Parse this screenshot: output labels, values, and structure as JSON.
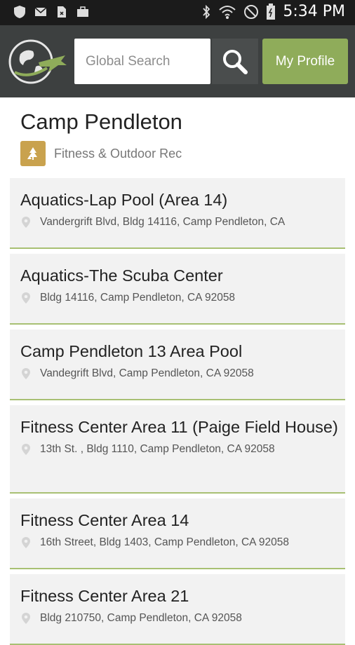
{
  "status_bar": {
    "time": "5:34 PM"
  },
  "header": {
    "search": {
      "placeholder": "Global Search"
    },
    "profile_label": "My Profile"
  },
  "page": {
    "title": "Camp Pendleton",
    "category": {
      "label": "Fitness & Outdoor Rec",
      "icon": "tree-icon"
    }
  },
  "colors": {
    "app_bar": "#3d4040",
    "accent": "#8fac5a",
    "category_icon_bg": "#c9a24e",
    "card_bg": "#f2f2f2",
    "card_divider": "#a8c073"
  },
  "locations": [
    {
      "name": "Aquatics-Lap Pool (Area 14)",
      "address": "Vandergrift Blvd, Bldg 14116, Camp Pendleton, CA"
    },
    {
      "name": "Aquatics-The Scuba Center",
      "address": "Bldg 14116, Camp Pendleton, CA 92058"
    },
    {
      "name": "Camp Pendleton 13 Area Pool",
      "address": "Vandegrift Blvd, Camp Pendleton, CA 92058"
    },
    {
      "name": "Fitness Center Area 11 (Paige Field House)",
      "address": "13th St. , Bldg 1110, Camp Pendleton, CA 92058"
    },
    {
      "name": "Fitness Center Area 14",
      "address": "16th Street, Bldg 1403, Camp Pendleton, CA 92058"
    },
    {
      "name": "Fitness Center Area 21",
      "address": "Bldg 210750, Camp Pendleton, CA 92058"
    }
  ]
}
